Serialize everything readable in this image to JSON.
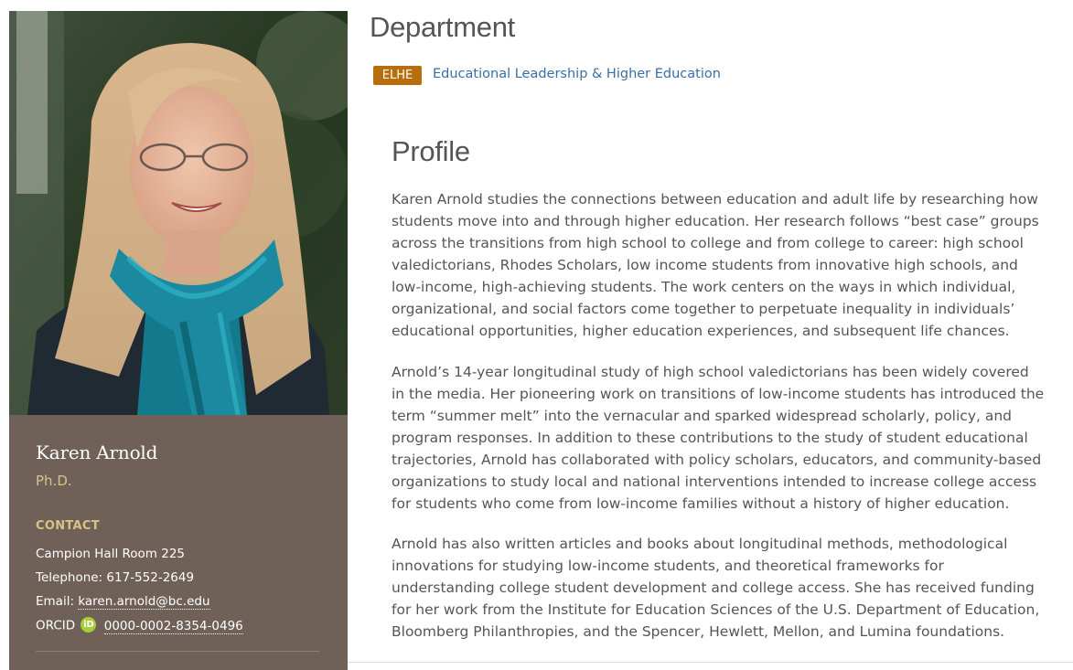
{
  "profile_card": {
    "name": "Karen Arnold",
    "degree": "Ph.D.",
    "contact_heading": "CONTACT",
    "office": "Campion Hall Room 225",
    "telephone_label": "Telephone:",
    "telephone": "617-552-2649",
    "email_label": "Email:",
    "email": "karen.arnold@bc.edu",
    "orcid_label": "ORCID",
    "orcid_icon_text": "iD",
    "orcid": "0000-0002-8354-0496"
  },
  "department": {
    "heading": "Department",
    "badge": "ELHE",
    "link": "Educational Leadership & Higher Education"
  },
  "profile": {
    "heading": "Profile",
    "paragraphs": [
      "Karen Arnold studies the connections between education and adult life by researching how students move into and through higher education. Her research follows “best case” groups across the transitions from high school to college and from college to career: high school valedictorians, Rhodes Scholars, low income students from innovative high schools, and low-income, high-achieving students. The work centers on the ways in which individual, organizational, and social factors come together to perpetuate inequality in individuals’ educational opportunities, higher education experiences, and subsequent life chances.",
      "Arnold’s 14-year longitudinal study of high school valedictorians has been widely covered in the media. Her pioneering work on transitions of low-income students has introduced the term “summer melt” into the vernacular and sparked widespread scholarly, policy, and program responses. In addition to these contributions to the study of student educational trajectories, Arnold has collaborated with policy scholars, educators, and community-based organizations to study local and national interventions intended to increase college access for students who come from low-income families without a history of higher education.",
      "Arnold has also written articles and books about longitudinal methods, methodological innovations for studying low-income students, and theoretical frameworks for understanding college student development and college access. She has received funding for her work from the Institute for Education Sciences of the U.S. Department of Education, Bloomberg Philanthropies, and the Spencer, Hewlett, Mellon, and Lumina foundations."
    ]
  },
  "colors": {
    "sidebar": "#6f6157",
    "accent_gold": "#d9c28a",
    "badge": "#b86e0c",
    "link": "#3a6ea5",
    "orcid_green": "#a6ce39"
  }
}
